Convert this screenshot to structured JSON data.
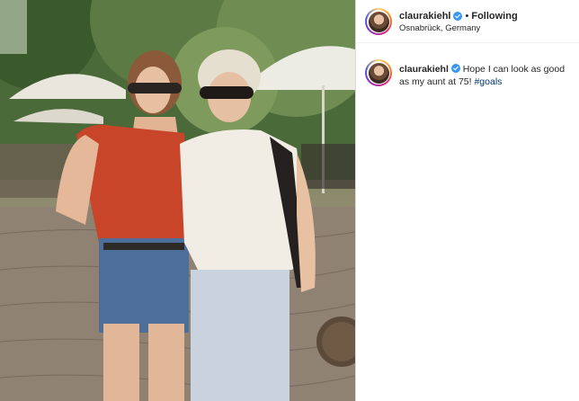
{
  "post": {
    "username": "claurakiehl",
    "separator": "•",
    "follow_status": "Following",
    "location": "Osnabrück, Germany"
  },
  "caption": {
    "username": "claurakiehl",
    "text": "Hope I can look as good as my aunt at 75!",
    "hashtag": "#goals"
  },
  "colors": {
    "verified": "#3897f0",
    "hashtag": "#00376b",
    "text": "#262626",
    "divider": "#dbdbdb"
  },
  "icons": {
    "verified": "verified-badge-icon",
    "avatar": "profile-avatar"
  }
}
